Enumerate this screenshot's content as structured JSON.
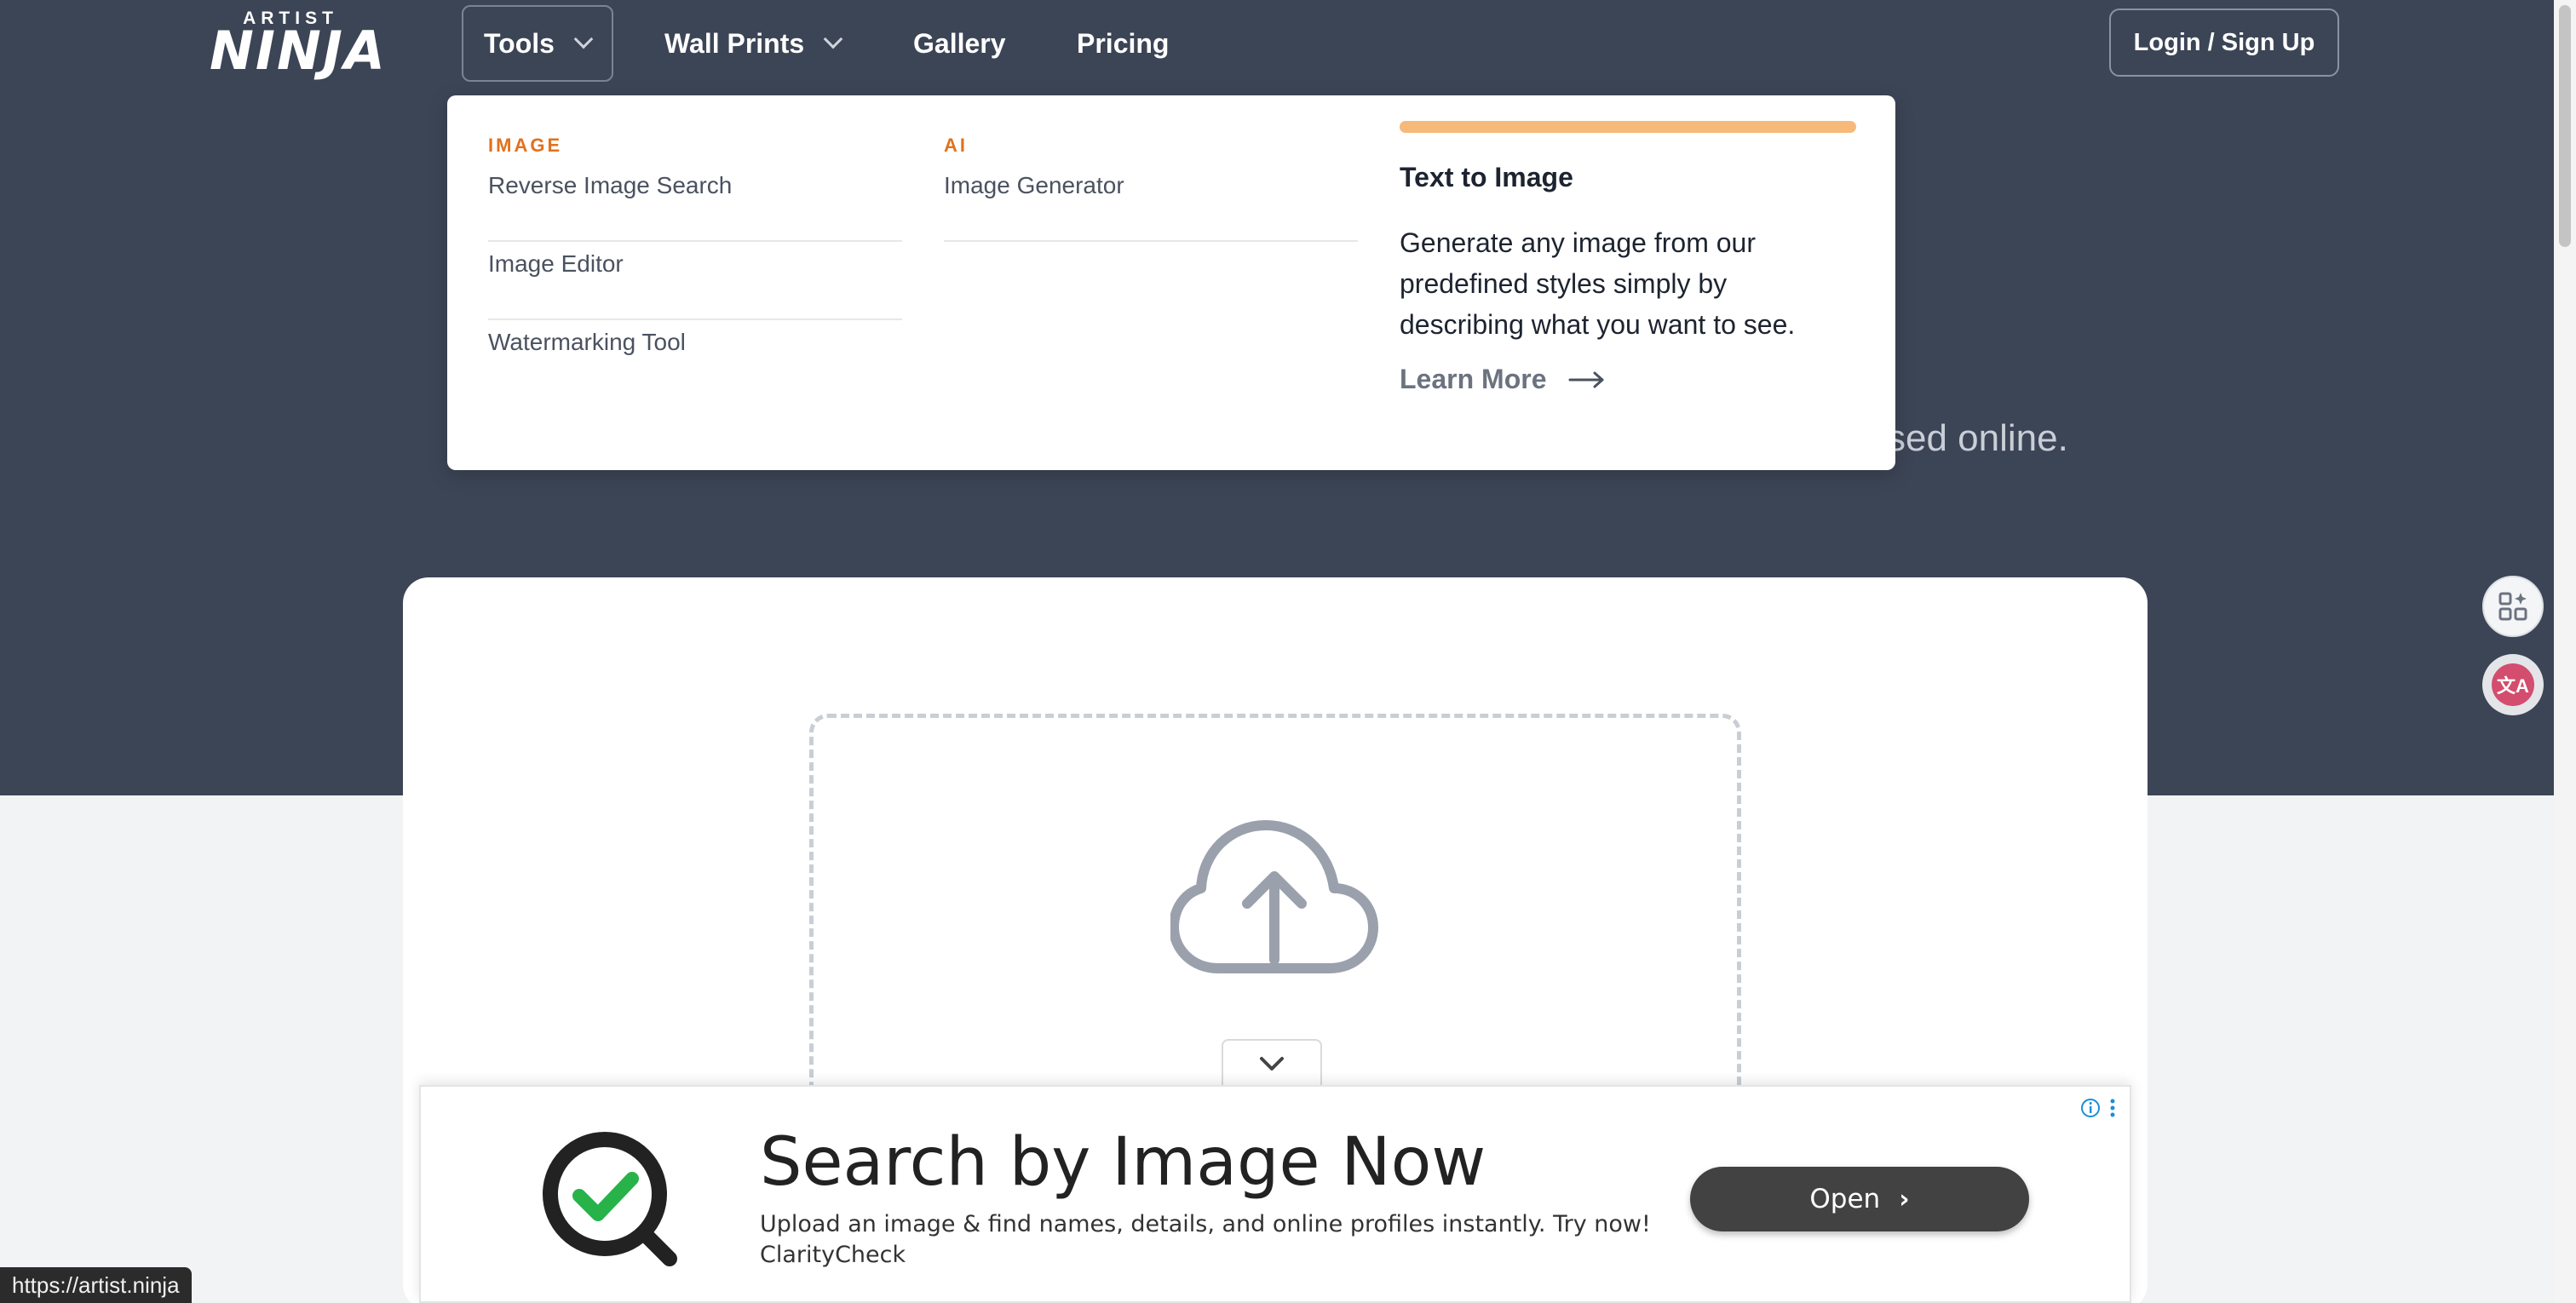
{
  "brand": {
    "logo_top": "ARTIST",
    "logo_bottom": "NINJA"
  },
  "nav": {
    "tools": "Tools",
    "wall_prints": "Wall Prints",
    "gallery": "Gallery",
    "pricing": "Pricing",
    "login": "Login / Sign Up"
  },
  "hero": {
    "subtitle_fragment": "sed online."
  },
  "dropdown": {
    "image_heading": "IMAGE",
    "image_links": [
      "Reverse Image Search",
      "Image Editor",
      "Watermarking Tool"
    ],
    "ai_heading": "AI",
    "ai_links": [
      "Image Generator"
    ],
    "feature": {
      "title": "Text to Image",
      "description": "Generate any image from our predefined styles simply by describing what you want to see.",
      "cta": "Learn More",
      "accent_color": "#f6b97a"
    }
  },
  "upload": {
    "icon": "cloud-upload-icon"
  },
  "ad": {
    "title": "Search by Image Now",
    "description": "Upload an image & find names, details, and online profiles instantly. Try now!",
    "brand": "ClarityCheck",
    "button": "Open"
  },
  "status_bar": {
    "url": "https://artist.ninja"
  },
  "colors": {
    "hero_bg": "#3c4556",
    "accent_orange": "#e2711d",
    "ad_button": "#424242"
  }
}
